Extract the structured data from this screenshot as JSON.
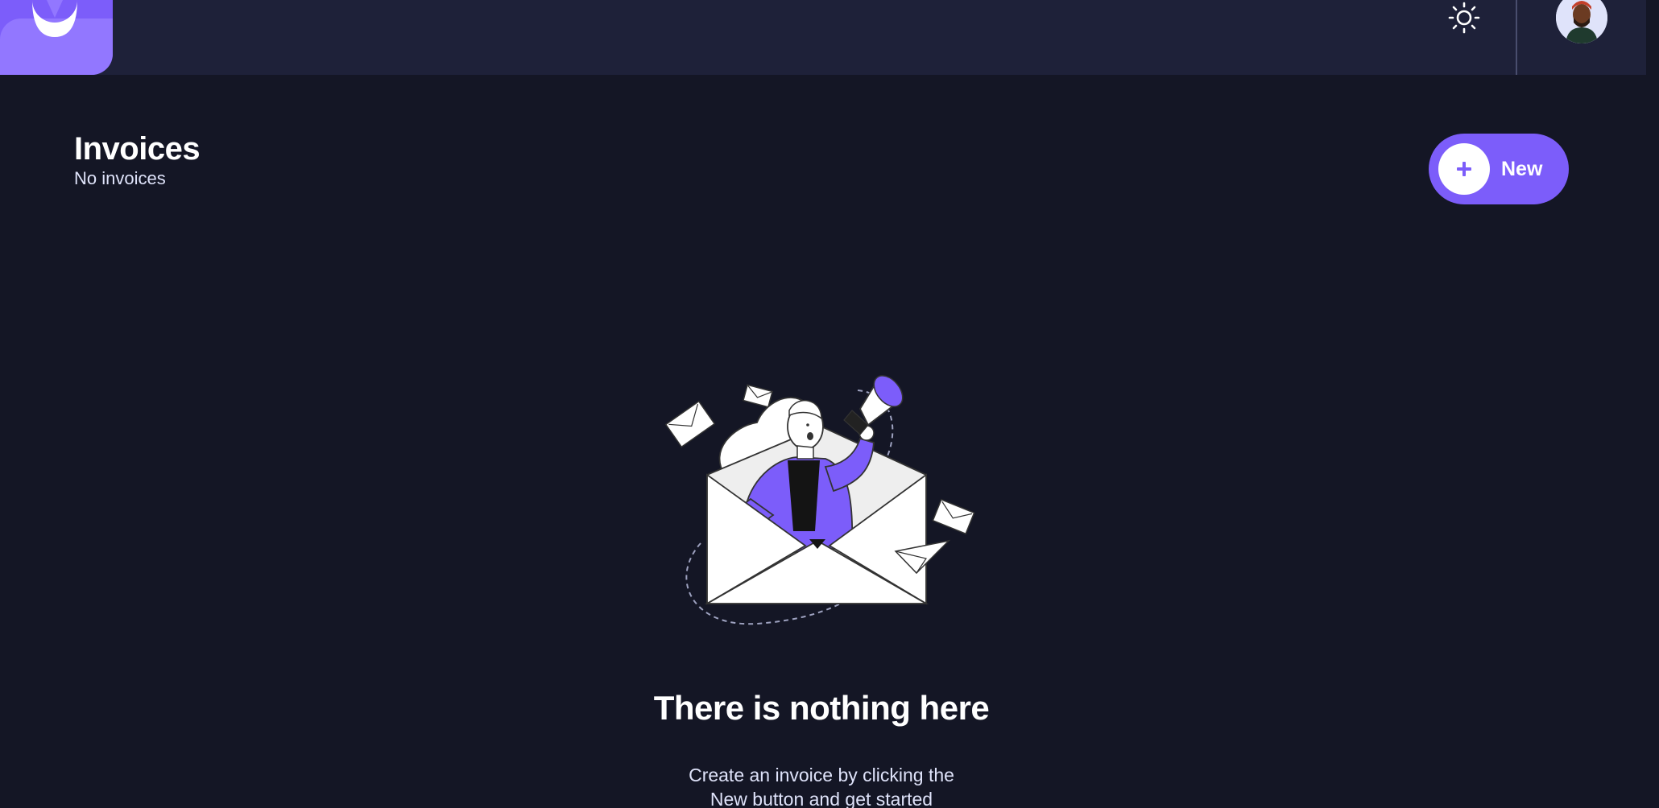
{
  "header": {
    "logo_icon": "app-logo-icon",
    "theme_icon": "sun-icon",
    "avatar_icon": "user-avatar"
  },
  "main": {
    "title": "Invoices",
    "subtitle": "No invoices",
    "new_button_label": "New",
    "new_button_icon": "plus-icon"
  },
  "empty_state": {
    "illustration": "person-megaphone-envelope-illustration",
    "heading": "There is nothing here",
    "text_line1": "Create an invoice by clicking the",
    "text_line2": "New button and get started"
  },
  "colors": {
    "background": "#141625",
    "topbar": "#1e2139",
    "accent": "#7c5dfa",
    "accent_light": "#9277ff",
    "text_muted": "#dfe3fa"
  }
}
